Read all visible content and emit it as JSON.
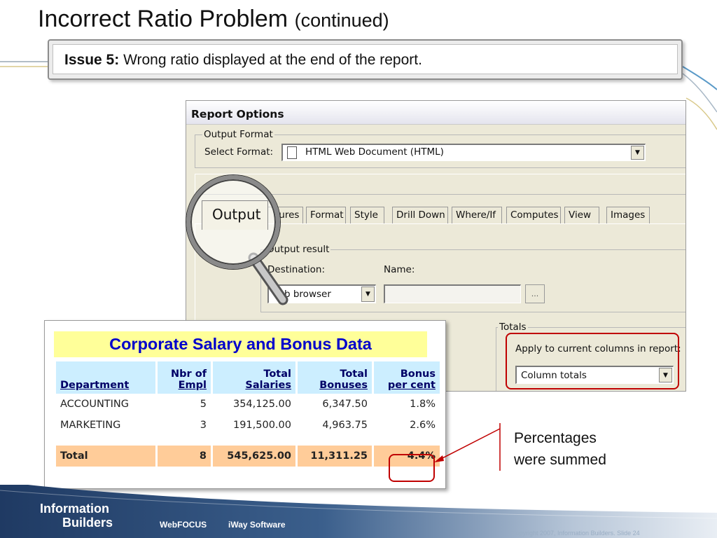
{
  "slide": {
    "title_main": "Incorrect Ratio Problem",
    "title_sub": "(continued)",
    "issue_label": "Issue 5:",
    "issue_text": "Wrong ratio displayed at the end of the report."
  },
  "report_options": {
    "title": "Report Options",
    "output_format_group": "Output Format",
    "select_format_label": "Select Format:",
    "select_format_value": "HTML Web Document (HTML)",
    "tabs": [
      "Output",
      "Features",
      "Format",
      "Style",
      "Drill Down",
      "Where/If",
      "Computes",
      "View",
      "Images"
    ],
    "tabs_visible": [
      "tures",
      "Format",
      "Style",
      "Drill Down",
      "Where/If",
      "Computes",
      "View",
      "Images"
    ],
    "output_result_group": "Output result",
    "destination_label": "Destination:",
    "name_label": "Name:",
    "destination_value": "b browser",
    "browse_button": "...",
    "totals_group": "Totals",
    "apply_label": "Apply to current columns in report:",
    "totals_value": "Column totals"
  },
  "magnifier": {
    "tab_label": "Output"
  },
  "salary_report": {
    "title": "Corporate Salary and Bonus Data",
    "headers": [
      {
        "line1": "",
        "line2": "Department"
      },
      {
        "line1": "Nbr of",
        "line2": "Empl"
      },
      {
        "line1": "Total",
        "line2": "Salaries"
      },
      {
        "line1": "Total",
        "line2": "Bonuses"
      },
      {
        "line1": "Bonus",
        "line2": "per cent"
      }
    ],
    "rows": [
      [
        "ACCOUNTING",
        "5",
        "354,125.00",
        "6,347.50",
        "1.8%"
      ],
      [
        "MARKETING",
        "3",
        "191,500.00",
        "4,963.75",
        "2.6%"
      ]
    ],
    "total": [
      "Total",
      "8",
      "545,625.00",
      "11,311.25",
      "4.4%"
    ]
  },
  "annotation": {
    "line1": "Percentages",
    "line2": "were summed"
  },
  "footer": {
    "logo_line1": "Information",
    "logo_line2": "Builders",
    "product1": "WebFOCUS",
    "product2": "iWay Software",
    "copyright": "Copyright 2007, Information Builders. Slide 24"
  },
  "colors": {
    "title_blue": "#0000cc",
    "title_yellow": "#ffff99",
    "header_blue": "#cceeff",
    "total_orange": "#ffcc99",
    "callout_red": "#c00000",
    "footer_navy": "#1f3a63"
  }
}
